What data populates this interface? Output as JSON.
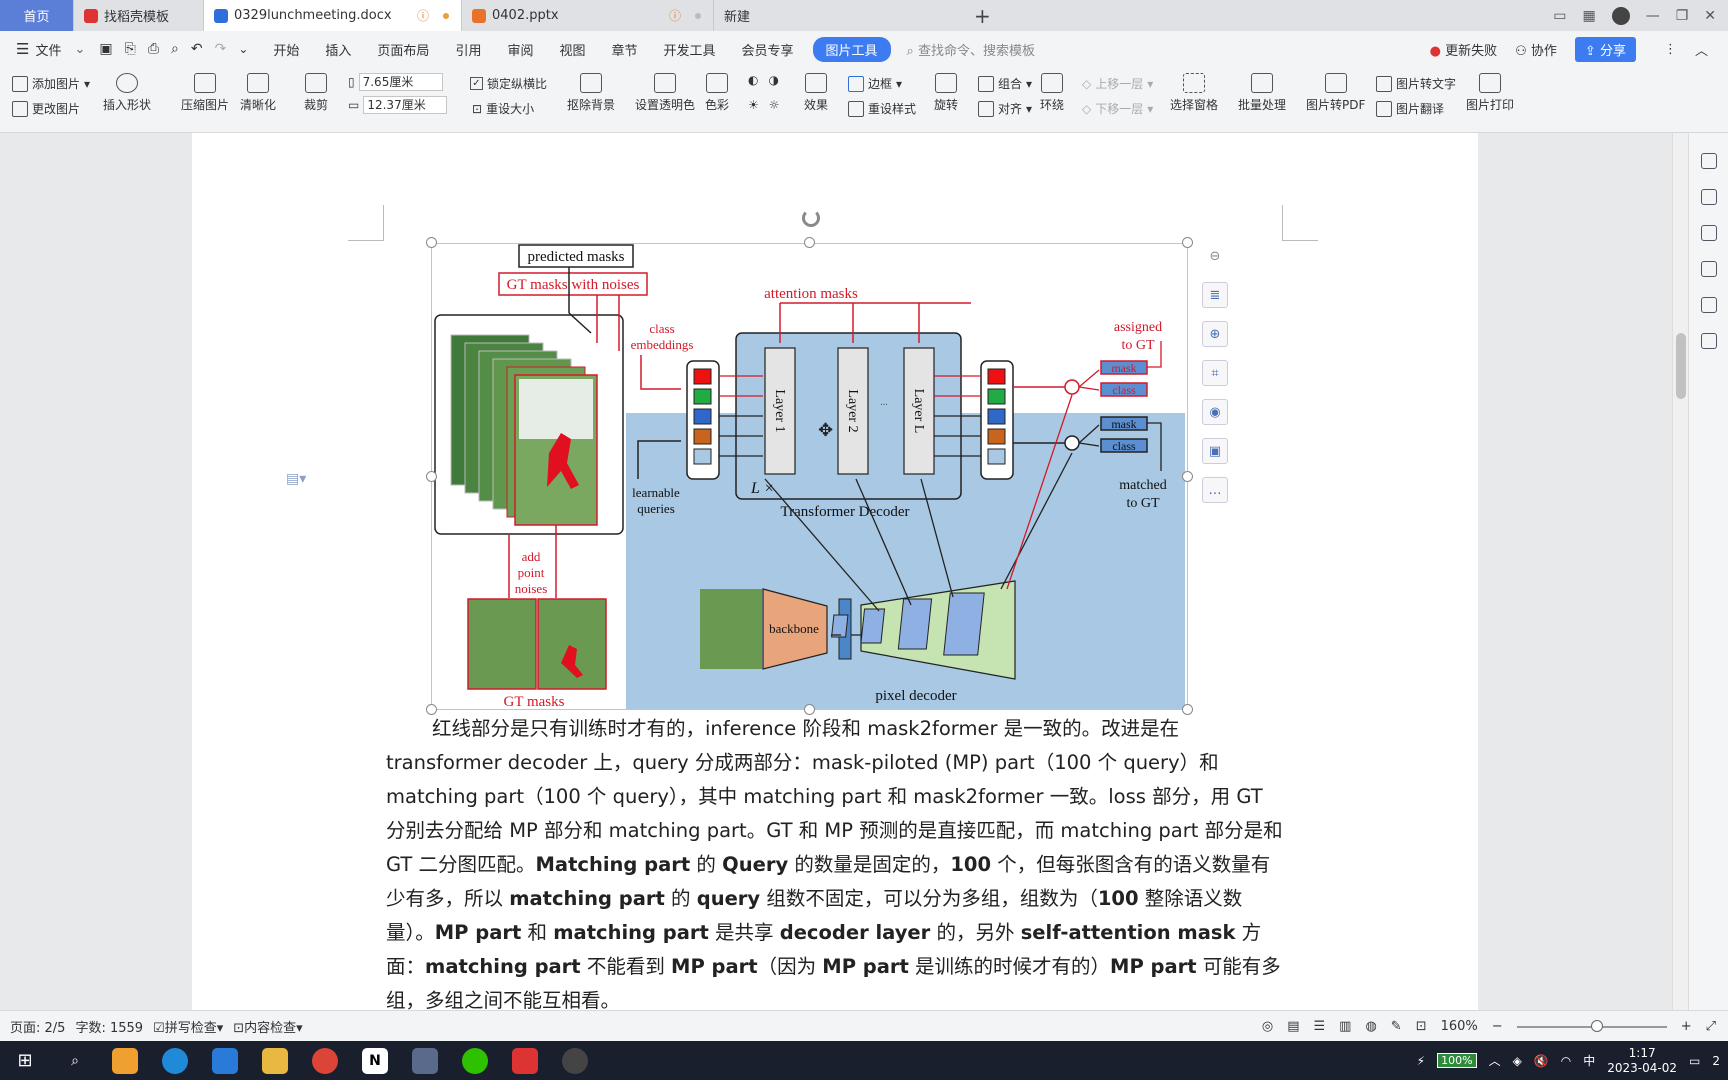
{
  "tabs": {
    "home": "首页",
    "t1": "找稻壳模板",
    "t2": "0329lunchmeeting.docx",
    "t3": "0402.pptx",
    "t4": "新建",
    "add": "+"
  },
  "menu": {
    "file": "文件",
    "items": [
      "开始",
      "插入",
      "页面布局",
      "引用",
      "审阅",
      "视图",
      "章节",
      "开发工具",
      "会员专享"
    ],
    "active": "图片工具",
    "search": "查找命令、搜索模板",
    "update_fail": "更新失败",
    "collab": "协作",
    "share": "分享"
  },
  "ribbon": {
    "add_image": "添加图片",
    "change_image": "更改图片",
    "insert_shape": "插入形状",
    "compress": "压缩图片",
    "sharpen": "清晰化",
    "crop": "裁剪",
    "width": "7.65厘米",
    "height": "12.37厘米",
    "lock_ratio": "锁定纵横比",
    "reset_size": "重设大小",
    "remove_bg": "抠除背景",
    "set_transparent": "设置透明色",
    "color": "色彩",
    "effects": "效果",
    "border": "边框",
    "reset_style": "重设样式",
    "rotate": "旋转",
    "group": "组合",
    "align": "对齐",
    "wrap": "环绕",
    "bring_forward": "上移一层",
    "send_backward": "下移一层",
    "select_pane": "选择窗格",
    "batch": "批量处理",
    "to_pdf": "图片转PDF",
    "to_text": "图片转文字",
    "translate": "图片翻译",
    "print": "图片打印"
  },
  "figure": {
    "predicted_masks": "predicted masks",
    "gt_masks_noises": "GT masks  with noises",
    "attention_masks": "attention masks",
    "class_embeddings": [
      "class",
      "embeddings"
    ],
    "learnable_queries": [
      "learnable",
      "queries"
    ],
    "layer1": "Layer 1",
    "layer2": "Layer 2",
    "layerL": "Layer L",
    "dots": "...",
    "lx": "L ×",
    "transformer_decoder": "Transformer Decoder",
    "assigned": [
      "assigned",
      "to GT"
    ],
    "matched": [
      "matched",
      "to GT"
    ],
    "mask": "mask",
    "class": "class",
    "add_noises": [
      "add",
      "point",
      "noises"
    ],
    "gt_masks": "GT masks",
    "backbone": "backbone",
    "pixel_decoder": "pixel decoder"
  },
  "body_text": {
    "p1": "红线部分是只有训练时才有的，inference 阶段和 mask2former 是一致的。改进是在 transformer decoder 上，query 分成两部分：mask-piloted (MP) part（100 个 query）和 matching part（100 个 query），其中 matching part 和 mask2former 一致。loss 部分，用 GT 分别去分配给 MP 部分和 matching part。GT 和 MP 预测的是直接匹配，而 matching part 部分是和 GT 二分图匹配。",
    "b1": "Matching part",
    "s1": " 的 ",
    "b2": "Query",
    "s2": " 的数量是固定的，",
    "b3": "100",
    "s3": " 个，但每张图含有的语义数量有少有多，所以 ",
    "b4": "matching part",
    "s4": " 的 ",
    "b5": "query",
    "s5": " 组数不固定，可以分为多组，组数为（",
    "b6": "100",
    "s6": " 整除语义数量）。",
    "b7": "MP part",
    "s7": " 和 ",
    "b8": "matching part",
    "s8": " 是共享 ",
    "b9": "decoder layer",
    "s9": " 的，另外 ",
    "b10": "self-attention mask",
    "s10": " 方面：",
    "b11": "matching part",
    "s11": " 不能看到 ",
    "b12": "MP part",
    "s12": "（因为 ",
    "b13": "MP part",
    "s13": " 是训练的时候才有的）",
    "b14": "MP part",
    "s14": " 可能有多组，多组之间不能互相看。"
  },
  "status": {
    "page": "页面: 2/5",
    "words": "字数: 1559",
    "spell": "拼写检查",
    "content": "内容检查",
    "zoom": "160%"
  },
  "taskbar": {
    "battery": "100%",
    "ime": "中",
    "time": "1:17",
    "date": "2023-04-02",
    "notif": "2"
  },
  "colors": {
    "accent": "#3d7bf0",
    "figure_red": "#d21a2a",
    "decoder_bg": "#a9c8e3",
    "backbone": "#e8a57c",
    "pixel_decoder": "#c6e3b2"
  }
}
